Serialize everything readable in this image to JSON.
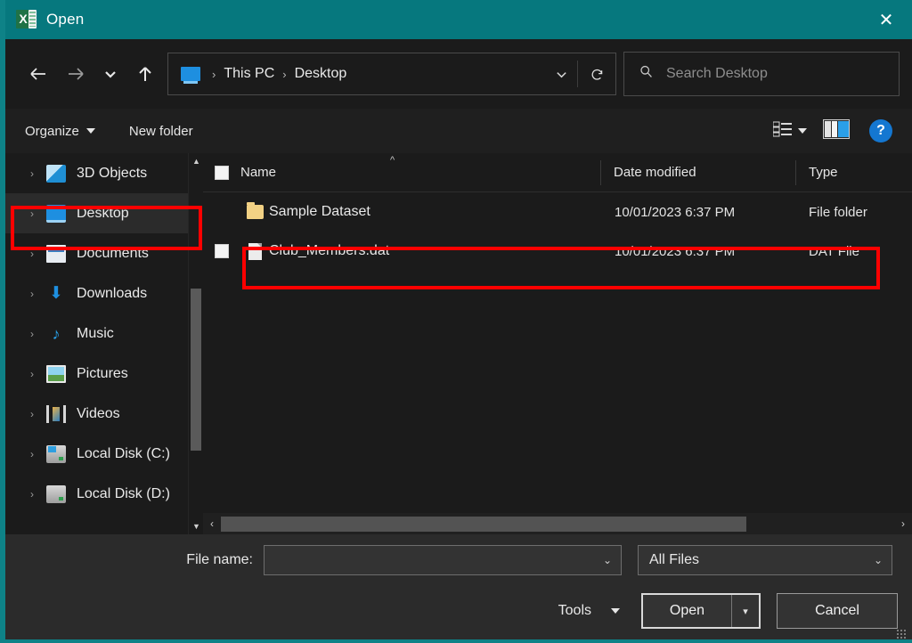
{
  "window": {
    "title": "Open",
    "app_icon": "excel-icon",
    "close_label": "✕",
    "titlebar_color": "#06787e"
  },
  "nav": {
    "back_icon": "arrow-left-icon",
    "forward_icon": "arrow-right-icon",
    "recent_icon": "chevron-down-icon",
    "up_icon": "arrow-up-icon",
    "refresh_icon": "refresh-icon",
    "breadcrumb": {
      "icon": "this-pc-icon",
      "items": [
        "This PC",
        "Desktop"
      ],
      "separator": "›",
      "dropdown_icon": "chevron-down-icon"
    },
    "search": {
      "icon": "search-icon",
      "placeholder": "Search Desktop",
      "value": ""
    }
  },
  "toolbar": {
    "organize_label": "Organize",
    "new_folder_label": "New folder",
    "view_icon": "view-list-icon",
    "view_dropdown_icon": "caret-down-icon",
    "preview_pane_icon": "preview-pane-icon",
    "help_label": "?"
  },
  "sidebar": {
    "items": [
      {
        "label": "3D Objects",
        "icon": "cube-icon",
        "selected": false
      },
      {
        "label": "Desktop",
        "icon": "monitor-icon",
        "selected": true
      },
      {
        "label": "Documents",
        "icon": "document-icon",
        "selected": false
      },
      {
        "label": "Downloads",
        "icon": "download-icon",
        "selected": false
      },
      {
        "label": "Music",
        "icon": "music-icon",
        "selected": false
      },
      {
        "label": "Pictures",
        "icon": "picture-icon",
        "selected": false
      },
      {
        "label": "Videos",
        "icon": "video-icon",
        "selected": false
      },
      {
        "label": "Local Disk (C:)",
        "icon": "drive-icon",
        "selected": false
      },
      {
        "label": "Local Disk (D:)",
        "icon": "drive-icon",
        "selected": false
      }
    ],
    "scroll_up_icon": "chevron-up-icon",
    "scroll_down_icon": "chevron-down-icon"
  },
  "file_list": {
    "columns": {
      "name": "Name",
      "date_modified": "Date modified",
      "type": "Type"
    },
    "sort_indicator": "^",
    "rows": [
      {
        "name": "Sample Dataset",
        "date_modified": "10/01/2023 6:37 PM",
        "type": "File folder",
        "icon": "folder-icon",
        "has_checkbox": false,
        "highlighted": false
      },
      {
        "name": "Club_Members.dat",
        "date_modified": "10/01/2023 6:37 PM",
        "type": "DAT File",
        "icon": "file-icon",
        "has_checkbox": true,
        "highlighted": true
      }
    ],
    "hscroll_left_icon": "chevron-left-icon",
    "hscroll_right_icon": "chevron-right-icon"
  },
  "footer": {
    "file_name_label": "File name:",
    "file_name_value": "",
    "file_name_dropdown_icon": "chevron-down-icon",
    "file_type_value": "All Files",
    "file_type_dropdown_icon": "chevron-down-icon",
    "tools_label": "Tools",
    "tools_dropdown_icon": "caret-down-icon",
    "open_label": "Open",
    "open_dropdown_icon": "caret-down-icon",
    "cancel_label": "Cancel",
    "resize_grip_icon": "resize-grip-icon"
  },
  "annotations": {
    "color": "#fe0000",
    "boxes": [
      {
        "target": "sidebar-item-desktop"
      },
      {
        "target": "file-row-club-members"
      }
    ]
  }
}
